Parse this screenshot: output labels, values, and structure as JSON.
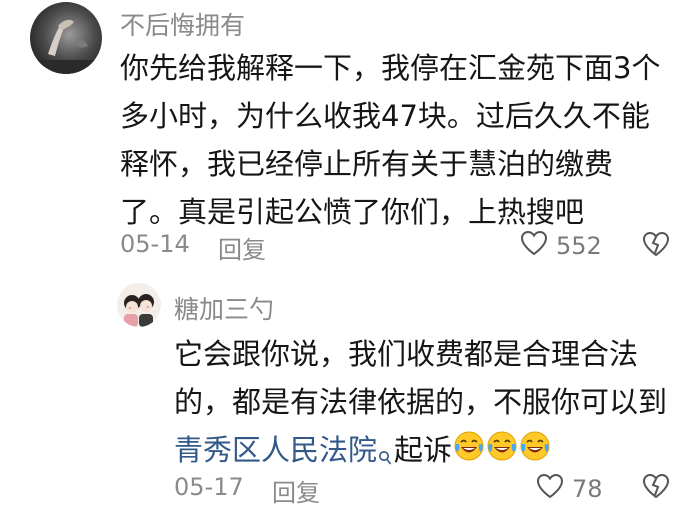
{
  "comments": [
    {
      "username": "不后悔拥有",
      "lines": [
        "你先给我解释一下，我停在汇金苑下面3个",
        "多小时，为什么收我47块。过后久久不能",
        "释怀，我已经停止所有关于慧泊的缴费",
        "了。真是引起公愤了你们，上热搜吧"
      ],
      "date": "05-14",
      "reply_label": "回复",
      "like_count": "552",
      "icons": {
        "like": "heart-outline-icon",
        "dislike": "broken-heart-icon"
      }
    },
    {
      "username": "糖加三勺",
      "lines": [
        "它会跟你说，我们收费都是合理合法",
        "的，都是有法律依据的，不服你可以到"
      ],
      "link_text": "青秀区人民法院",
      "after_link": "起诉",
      "emoji_names": [
        "laughing-crying-emoji",
        "laughing-crying-emoji",
        "laughing-crying-emoji"
      ],
      "date": "05-17",
      "reply_label": "回复",
      "like_count": "78",
      "icons": {
        "like": "heart-outline-icon",
        "dislike": "broken-heart-icon",
        "link": "search-icon"
      }
    }
  ],
  "colors": {
    "text": "#161616",
    "muted": "#8a8a8a",
    "link": "#33598a"
  }
}
